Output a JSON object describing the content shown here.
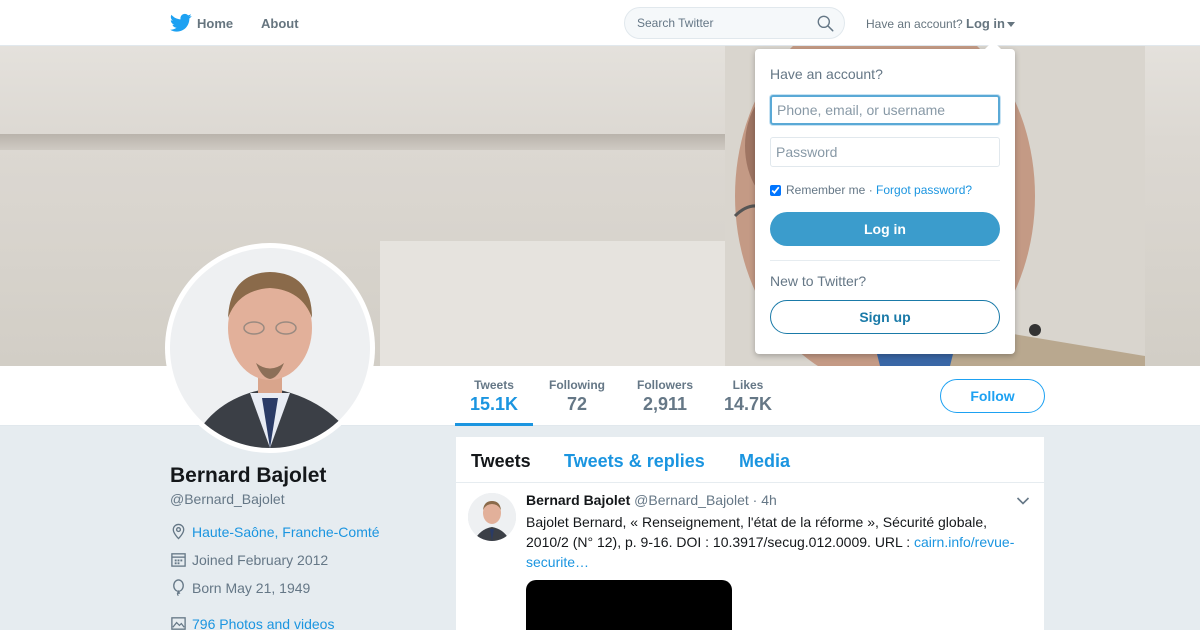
{
  "nav": {
    "home_label": "Home",
    "about_label": "About",
    "search_placeholder": "Search Twitter",
    "have_account": "Have an account?",
    "login_label": "Log in"
  },
  "profile": {
    "name": "Bernard Bajolet",
    "handle": "@Bernard_Bajolet",
    "location": "Haute-Saône, Franche-Comté",
    "joined": "Joined February 2012",
    "born": "Born May 21, 1949",
    "photos": "796 Photos and videos",
    "follow_label": "Follow"
  },
  "stats": [
    {
      "label": "Tweets",
      "value": "15.1K"
    },
    {
      "label": "Following",
      "value": "72"
    },
    {
      "label": "Followers",
      "value": "2,911"
    },
    {
      "label": "Likes",
      "value": "14.7K"
    }
  ],
  "timeline": {
    "tabs": [
      "Tweets",
      "Tweets & replies",
      "Media"
    ],
    "tweet": {
      "name": "Bernard Bajolet",
      "handle": "@Bernard_Bajolet",
      "time": "· 4h",
      "text": "Bajolet Bernard, « Renseignement, l'état de la réforme », Sécurité globale, 2010/2 (N° 12), p. 9-16. DOI : 10.3917/secug.012.0009. URL : ",
      "link": "cairn.info/revue-securite…"
    }
  },
  "login_dropdown": {
    "title": "Have an account?",
    "username_placeholder": "Phone, email, or username",
    "password_placeholder": "Password",
    "remember": "Remember me",
    "separator": " · ",
    "forgot": "Forgot password?",
    "login_button": "Log in",
    "new_to_twitter": "New to Twitter?",
    "signup_button": "Sign up"
  },
  "colors": {
    "accent": "#1da1f2",
    "link": "#1b95e0",
    "login_button_bg": "#3b9ccc",
    "background": "#e6ecf0"
  },
  "icons": [
    "twitter-bird-icon",
    "search-icon",
    "location-icon",
    "calendar-icon",
    "balloon-icon",
    "photo-icon",
    "chevron-down-icon"
  ]
}
